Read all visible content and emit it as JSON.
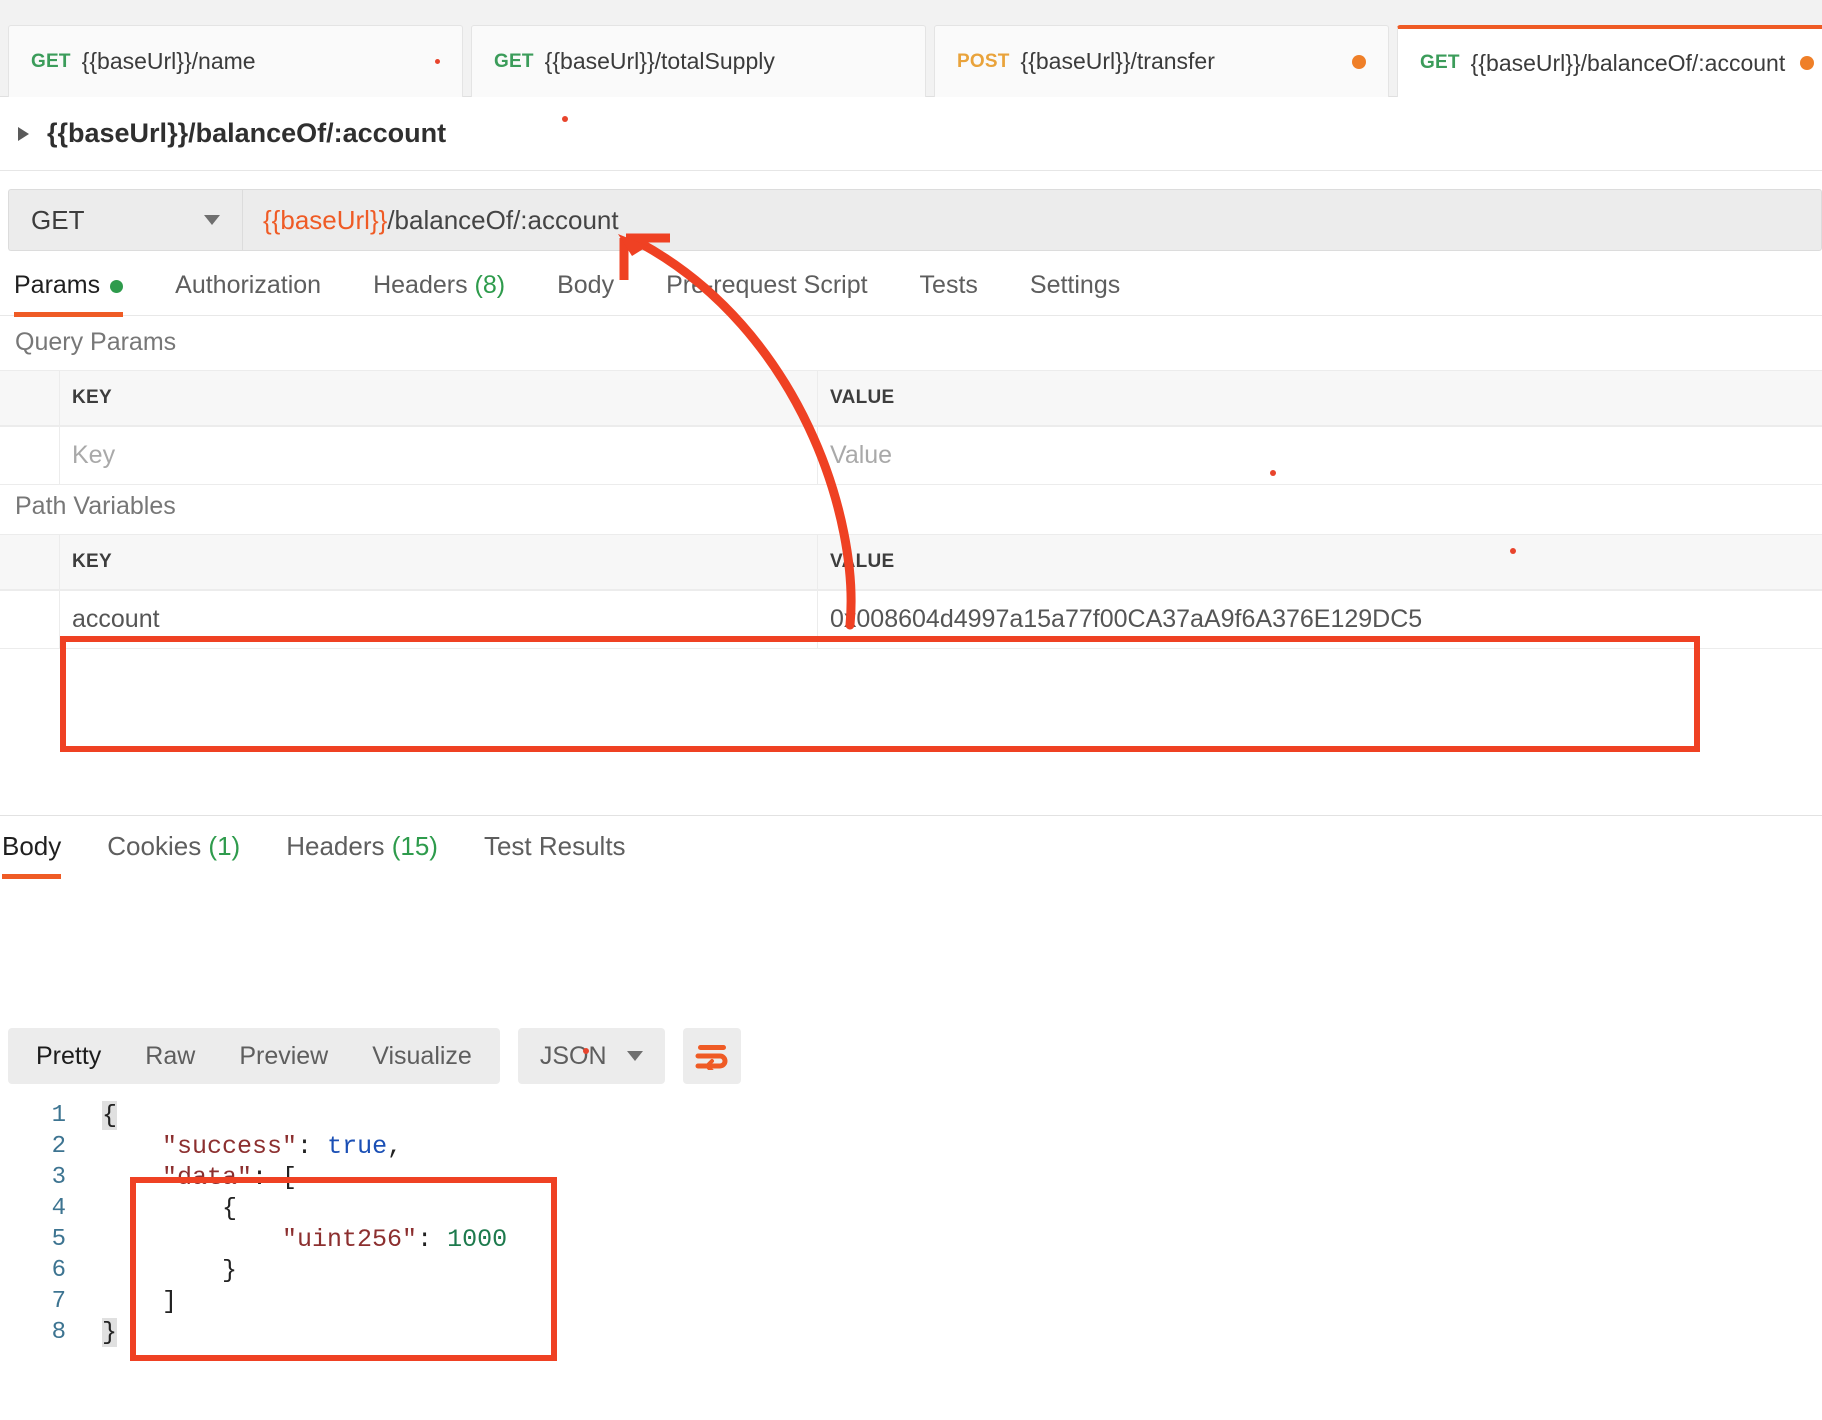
{
  "tabs": [
    {
      "method": "GET",
      "name": "{{baseUrl}}/name",
      "dirty": "tiny",
      "active": false
    },
    {
      "method": "GET",
      "name": "{{baseUrl}}/totalSupply",
      "dirty": "none",
      "active": false
    },
    {
      "method": "POST",
      "name": "{{baseUrl}}/transfer",
      "dirty": "dot",
      "active": false
    },
    {
      "method": "GET",
      "name": "{{baseUrl}}/balanceOf/:account",
      "dirty": "dot",
      "active": true
    }
  ],
  "request": {
    "title": "{{baseUrl}}/balanceOf/:account",
    "method": "GET",
    "url_var": "{{baseUrl}}",
    "url_rest": "/balanceOf/:account",
    "tabs": [
      {
        "label": "Params",
        "suffix": "",
        "active": true,
        "dot": true
      },
      {
        "label": "Authorization",
        "suffix": "",
        "active": false,
        "dot": false
      },
      {
        "label": "Headers",
        "suffix": "(8)",
        "active": false,
        "dot": false
      },
      {
        "label": "Body",
        "suffix": "",
        "active": false,
        "dot": false
      },
      {
        "label": "Pre-request Script",
        "suffix": "",
        "active": false,
        "dot": false
      },
      {
        "label": "Tests",
        "suffix": "",
        "active": false,
        "dot": false
      },
      {
        "label": "Settings",
        "suffix": "",
        "active": false,
        "dot": false
      }
    ]
  },
  "query_params": {
    "section_label": "Query Params",
    "headers": {
      "key": "KEY",
      "value": "VALUE"
    },
    "rows": [
      {
        "key": "",
        "value": "",
        "key_placeholder": "Key",
        "value_placeholder": "Value"
      }
    ]
  },
  "path_variables": {
    "section_label": "Path Variables",
    "headers": {
      "key": "KEY",
      "value": "VALUE"
    },
    "rows": [
      {
        "key": "account",
        "value": "0x008604d4997a15a77f00CA37aA9f6A376E129DC5"
      }
    ]
  },
  "response": {
    "tabs": [
      {
        "label": "Body",
        "suffix": "",
        "active": true
      },
      {
        "label": "Cookies",
        "suffix": "(1)",
        "active": false
      },
      {
        "label": "Headers",
        "suffix": "(15)",
        "active": false
      },
      {
        "label": "Test Results",
        "suffix": "",
        "active": false
      }
    ],
    "view_modes": [
      {
        "label": "Pretty",
        "active": true
      },
      {
        "label": "Raw",
        "active": false
      },
      {
        "label": "Preview",
        "active": false
      },
      {
        "label": "Visualize",
        "active": false
      }
    ],
    "format": "JSON",
    "wrap_icon": "wrap-lines-icon",
    "body_lines": [
      {
        "n": "1",
        "segments": [
          {
            "t": "{",
            "c": "k-pun brace-hl"
          }
        ]
      },
      {
        "n": "2",
        "segments": [
          {
            "t": "    ",
            "c": "k-pun"
          },
          {
            "t": "\"success\"",
            "c": "k-key"
          },
          {
            "t": ": ",
            "c": "k-pun"
          },
          {
            "t": "true",
            "c": "k-bool"
          },
          {
            "t": ",",
            "c": "k-pun"
          }
        ]
      },
      {
        "n": "3",
        "segments": [
          {
            "t": "    ",
            "c": "k-pun"
          },
          {
            "t": "\"data\"",
            "c": "k-key"
          },
          {
            "t": ": [",
            "c": "k-pun"
          }
        ]
      },
      {
        "n": "4",
        "segments": [
          {
            "t": "        {",
            "c": "k-pun"
          }
        ]
      },
      {
        "n": "5",
        "segments": [
          {
            "t": "            ",
            "c": "k-pun"
          },
          {
            "t": "\"uint256\"",
            "c": "k-key"
          },
          {
            "t": ": ",
            "c": "k-pun"
          },
          {
            "t": "1000",
            "c": "k-num"
          }
        ]
      },
      {
        "n": "6",
        "segments": [
          {
            "t": "        }",
            "c": "k-pun"
          }
        ]
      },
      {
        "n": "7",
        "segments": [
          {
            "t": "    ]",
            "c": "k-pun"
          }
        ]
      },
      {
        "n": "8",
        "segments": [
          {
            "t": "}",
            "c": "k-pun brace-hl"
          }
        ]
      }
    ]
  },
  "annotations": {
    "accent_color": "#ef4123",
    "arrow": "curved-arrow-to-url",
    "highlight_path_variables": "path-variables-row-highlight",
    "highlight_json_data": "json-data-array-highlight"
  }
}
